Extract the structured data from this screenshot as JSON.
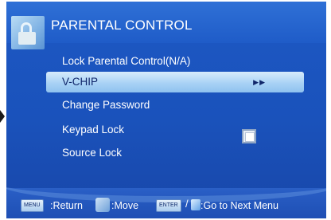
{
  "header": {
    "title": "PARENTAL CONTROL",
    "icon": "lock-icon"
  },
  "menu": {
    "items": [
      {
        "label": "Lock Parental Control(N/A)",
        "selected": false
      },
      {
        "label": "V-CHIP",
        "selected": true,
        "indicator": "▶▶"
      },
      {
        "label": "Change Password",
        "selected": false
      },
      {
        "label": "Keypad Lock",
        "selected": false,
        "checkbox": true
      },
      {
        "label": "Source Lock",
        "selected": false
      }
    ]
  },
  "footer": {
    "menu_key": "MENU",
    "return_label": ":Return",
    "move_label": ":Move",
    "enter_key": "ENTER",
    "slash": "/",
    "next_label": ":Go to Next Menu"
  },
  "colors": {
    "background": "#1d58c4",
    "highlight": "#a9d2f5",
    "text": "#ffffff"
  }
}
